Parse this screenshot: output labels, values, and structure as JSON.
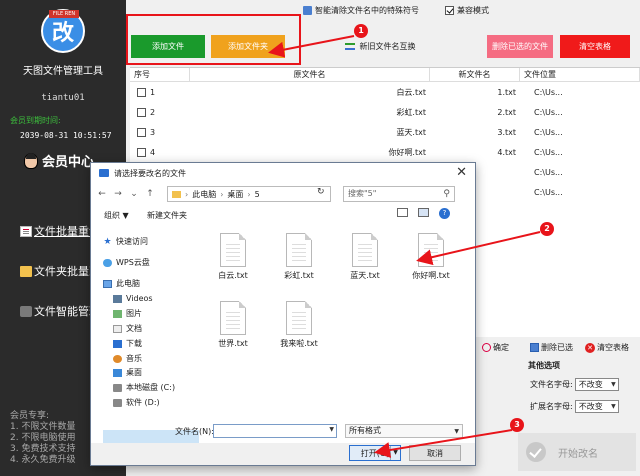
{
  "sidebar": {
    "logo_tag": "FILE REN",
    "logo_char": "改",
    "app_title": "天图文件管理工具",
    "username": "tiantu01",
    "expire_label": "会员到期时间:",
    "expire_date": "2039-08-31 10:51:57",
    "vip_text": "会员中心",
    "nav": [
      {
        "label": "文件批量重命",
        "icon": "document-icon"
      },
      {
        "label": "文件夹批量改",
        "icon": "folder-icon"
      },
      {
        "label": "文件智能管理",
        "icon": "gamepad-icon"
      }
    ],
    "vip_benefits": [
      "会员专享:",
      "1. 不限文件数量",
      "2. 不限电脑使用",
      "3. 免费技术支持",
      "4. 永久免费升级"
    ]
  },
  "topbar": {
    "special_label": "智能清除文件名中的特殊符号",
    "compat_label": "兼容模式",
    "compat_checked": true
  },
  "toolbar": {
    "add_file": "添加文件",
    "add_folder": "添加文件夹",
    "swap": "新旧文件名互换",
    "delete_selected": "删除已选的文件",
    "clear_table": "清空表格"
  },
  "table": {
    "headers": [
      "序号",
      "原文件名",
      "新文件名",
      "文件位置"
    ],
    "rows": [
      {
        "idx": "1",
        "orig": "白云.txt",
        "new": "1.txt",
        "path": "C:\\Us..."
      },
      {
        "idx": "2",
        "orig": "彩虹.txt",
        "new": "2.txt",
        "path": "C:\\Us..."
      },
      {
        "idx": "3",
        "orig": "蓝天.txt",
        "new": "3.txt",
        "path": "C:\\Us..."
      },
      {
        "idx": "4",
        "orig": "你好啊.txt",
        "new": "4.txt",
        "path": "C:\\Us..."
      },
      {
        "idx": "",
        "orig": "",
        "new": "",
        "path": "C:\\Us..."
      },
      {
        "idx": "",
        "orig": "",
        "new": "",
        "path": "C:\\Us..."
      }
    ]
  },
  "actions": {
    "confirm": "确定",
    "delete_selected": "删除已选",
    "clear_table": "清空表格"
  },
  "options": {
    "title": "其他选项",
    "filename_case_label": "文件名字母:",
    "filename_case_value": "不改变",
    "ext_case_label": "扩展名字母:",
    "ext_case_value": "不改变",
    "start_label": "开始改名"
  },
  "dialog": {
    "title": "请选择要改名的文件",
    "path": [
      "此电脑",
      "桌面",
      "5"
    ],
    "search_placeholder": "搜索\"5\"",
    "organize": "组织 ▼",
    "new_folder": "新建文件夹",
    "nav_items": [
      {
        "label": "快速访问",
        "icon": "star-icon"
      },
      {
        "label": "WPS云盘",
        "icon": "cloud-icon"
      },
      {
        "label": "此电脑",
        "icon": "computer-icon"
      },
      {
        "label": "Videos",
        "icon": "video-icon"
      },
      {
        "label": "图片",
        "icon": "picture-icon"
      },
      {
        "label": "文档",
        "icon": "documents-icon"
      },
      {
        "label": "下载",
        "icon": "download-icon"
      },
      {
        "label": "音乐",
        "icon": "music-icon"
      },
      {
        "label": "桌面",
        "icon": "desktop-icon"
      },
      {
        "label": "本地磁盘 (C:)",
        "icon": "drive-icon"
      },
      {
        "label": "软件 (D:)",
        "icon": "drive-icon"
      }
    ],
    "files": [
      "白云.txt",
      "彩虹.txt",
      "蓝天.txt",
      "你好啊.txt",
      "世界.txt",
      "我来啦.txt"
    ],
    "filename_label": "文件名(N):",
    "filetype_value": "所有格式",
    "open_button": "打开(O)",
    "cancel_button": "取消"
  },
  "annotations": [
    "1",
    "2",
    "3"
  ],
  "colors": {
    "add_file": "#1a9a2c",
    "add_folder": "#f0a21d",
    "delete_selected": "#f56c82",
    "clear_table": "#f01a1a",
    "annotation": "#e8141a",
    "sidebar_bg": "#2b2b2b"
  }
}
